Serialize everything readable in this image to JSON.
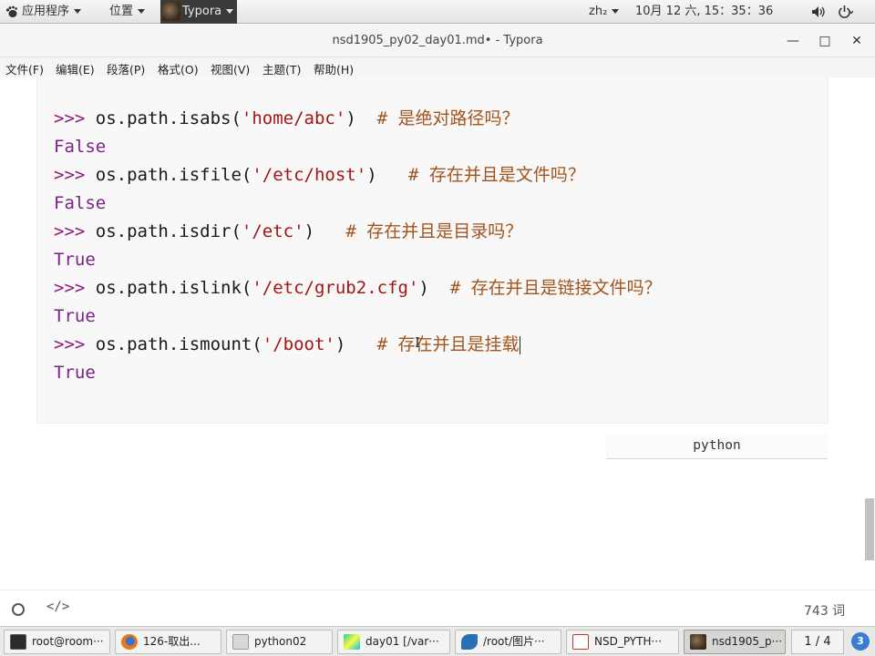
{
  "top_panel": {
    "apps_menu": "应用程序",
    "places_menu": "位置",
    "active_app": "Typora",
    "input_method": "zh₂",
    "clock": "10月 12 六, 15：35：36",
    "icons": [
      "gnome-foot-icon",
      "volume-icon",
      "power-icon"
    ]
  },
  "window": {
    "title": "nsd1905_py02_day01.md• - Typora",
    "minimize": "—",
    "maximize": "□",
    "close": "✕"
  },
  "menu": [
    "文件(F)",
    "编辑(E)",
    "段落(P)",
    "格式(O)",
    "视图(V)",
    "主题(T)",
    "帮助(H)"
  ],
  "code_block": {
    "language": "python",
    "lines": [
      {
        "prompt": ">>>",
        "code": " os.path.isabs(",
        "string": "'home/abc'",
        "close": ")",
        "comment": "  # 是绝对路径吗？"
      },
      {
        "output": "False"
      },
      {
        "prompt": ">>>",
        "code": " os.path.isfile(",
        "string": "'/etc/host'",
        "close": ")",
        "comment": "   # 存在并且是文件吗？"
      },
      {
        "output": "False"
      },
      {
        "prompt": ">>>",
        "code": " os.path.isdir(",
        "string": "'/etc'",
        "close": ")",
        "comment": "   # 存在并且是目录吗？"
      },
      {
        "output": "True"
      },
      {
        "prompt": ">>>",
        "code": " os.path.islink(",
        "string": "'/etc/grub2.cfg'",
        "close": ")",
        "comment": "  # 存在并且是链接文件吗？"
      },
      {
        "output": "True"
      },
      {
        "prompt": ">>>",
        "code": " os.path.ismount(",
        "string": "'/boot'",
        "close": ")",
        "comment": "   # 存在并且是挂载"
      },
      {
        "output": "True"
      }
    ]
  },
  "status_bar": {
    "source_mode": "</>",
    "word_count": "743 词"
  },
  "taskbar": {
    "tasks": [
      {
        "label": "root@room···"
      },
      {
        "label": "126-取出..."
      },
      {
        "label": "python02"
      },
      {
        "label": "day01 [/var···"
      },
      {
        "label": "/root/图片···"
      },
      {
        "label": "NSD_PYTH···"
      },
      {
        "label": "nsd1905_p···"
      }
    ],
    "workspace": "1 / 4",
    "badge": "3"
  },
  "colors": {
    "prompt": "#8b1c7e",
    "string": "#a31515",
    "comment": "#a4531c",
    "output": "#7b2288",
    "code_background": "#f8f8f8"
  }
}
